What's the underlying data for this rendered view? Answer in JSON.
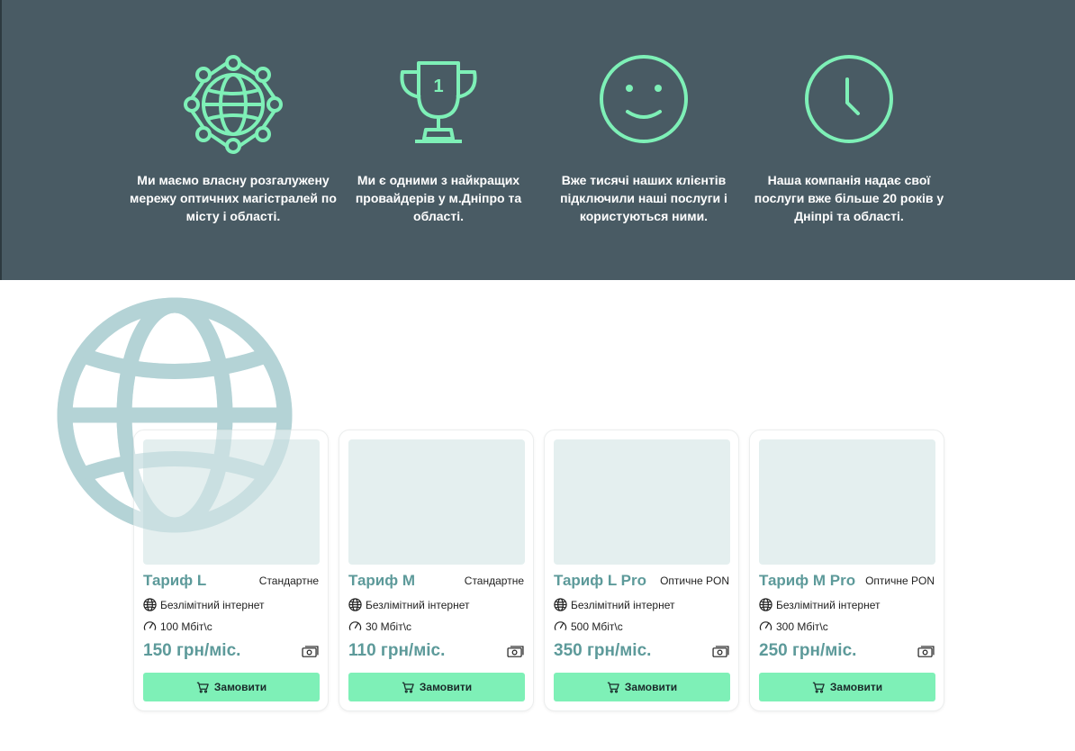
{
  "colors": {
    "hero_bg": "#495b64",
    "accent_green": "#7ef0b7",
    "teal_text": "#5d9a9a",
    "globe_watermark": "#b4d3d6",
    "image_placeholder": "#e4efef"
  },
  "features": [
    {
      "icon": "network-globe-icon",
      "text": "Ми маємо власну розгалужену мережу оптичних магістралей по місту і області."
    },
    {
      "icon": "trophy-icon",
      "trophy_number": "1",
      "text": "Ми є одними з найкращих провайдерів у м.Дніпро та області."
    },
    {
      "icon": "smiley-icon",
      "text": "Вже тисячі наших клієнтів підключили наші послуги і користуються ними."
    },
    {
      "icon": "clock-icon",
      "text": "Наша компанія надає свої послуги вже більше 20 років у Дніпрі та області."
    }
  ],
  "tariffs": [
    {
      "name": "Тариф L",
      "type": "Стандартне",
      "internet": "Безлімітний інтернет",
      "speed": "100 Мбіт\\с",
      "price": "150 грн/міс.",
      "button": "Замовити"
    },
    {
      "name": "Тариф M",
      "type": "Стандартне",
      "internet": "Безлімітний інтернет",
      "speed": "30 Мбіт\\с",
      "price": "110 грн/міс.",
      "button": "Замовити"
    },
    {
      "name": "Тариф L Pro",
      "type": "Оптичне PON",
      "internet": "Безлімітний інтернет",
      "speed": "500 Мбіт\\с",
      "price": "350 грн/міс.",
      "button": "Замовити"
    },
    {
      "name": "Тариф M Pro",
      "type": "Оптичне PON",
      "internet": "Безлімітний інтернет",
      "speed": "300 Мбіт\\с",
      "price": "250 грн/міс.",
      "button": "Замовити"
    }
  ]
}
